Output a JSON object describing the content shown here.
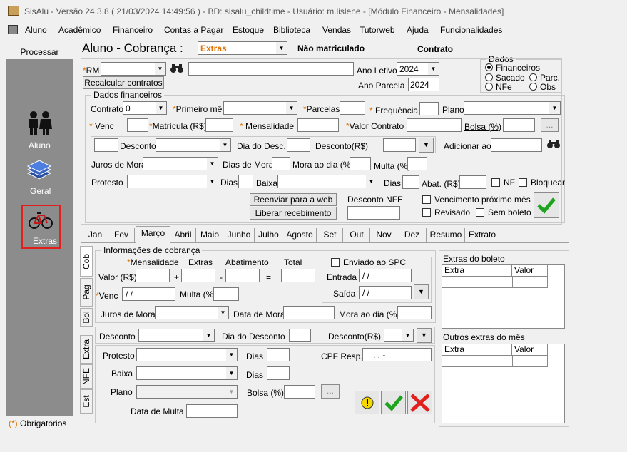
{
  "window": {
    "title": "SisAlu - Versão 24.3.8 ( 21/03/2024 14:49:56 ) - BD: sisalu_childtime - Usuário: m.lislene - [Módulo Financeiro - Mensalidades]",
    "menu": [
      "Aluno",
      "Acadêmico",
      "Financeiro",
      "Contas a Pagar",
      "Estoque",
      "Biblioteca",
      "Vendas",
      "Tutorweb",
      "Ajuda",
      "Funcionalidades"
    ]
  },
  "sidebar": {
    "header": "Processar",
    "items": [
      {
        "label": "Aluno",
        "icon": "people-icon"
      },
      {
        "label": "Geral",
        "icon": "stack-icon"
      },
      {
        "label": "Extras",
        "icon": "bicycle-icon",
        "selected": true
      }
    ],
    "footer_star": "(*)",
    "footer": "Obrigatórios"
  },
  "header": {
    "title": "Aluno  - Cobrança :",
    "type_value": "Extras",
    "status1": "Não matriculado",
    "status2": "Contrato"
  },
  "dados": {
    "title": "Dados",
    "options": [
      "Financeiros",
      "Sacado",
      "Parc.",
      "NFe",
      "Obs"
    ]
  },
  "top": {
    "rm_label": "RM",
    "recalc_button": "Recalcular contratos",
    "ano_letivo_label": "Ano Letivo",
    "ano_letivo_value": "2024",
    "ano_parcela_label": "Ano Parcela",
    "ano_parcela_value": "2024"
  },
  "fin": {
    "title": "Dados financeiros",
    "contrato_label": "Contrato",
    "contrato_value": "0",
    "primeiro_mes_label": "Primeiro mês",
    "parcelas_label": "Parcelas",
    "frequencia_label": "Frequência",
    "plano_label": "Plano",
    "venc_label": "Venc",
    "matricula_label": "Matrícula (R$)",
    "mensalidade_label": "Mensalidade",
    "valor_contrato_label": "Valor Contrato",
    "bolsa_label": "Bolsa (%)",
    "ellipsis": "...",
    "desconto_label": "Desconto",
    "dia_desc_label": "Dia do Desc.",
    "desconto_rs_label": "Desconto(R$)",
    "adicionar_label": "Adicionar ao",
    "juros_label": "Juros de Mora",
    "dias_mora_label": "Dias de Mora",
    "mora_dia_label": "Mora ao dia (%)",
    "multa_label": "Multa (%)",
    "protesto_label": "Protesto",
    "dias_label": "Dias",
    "baixa_label": "Baixa",
    "dias2_label": "Dias",
    "abat_label": "Abat. (R$)",
    "nf_label": "NF",
    "bloquear_label": "Bloquear",
    "reenviar_button": "Reenviar para a web",
    "liberar_button": "Liberar recebimento",
    "desconto_nfe_label": "Desconto NFE",
    "venc_prox_label": "Vencimento próximo mês",
    "revisado_label": "Revisado",
    "sem_boleto_label": "Sem boleto"
  },
  "tabs": [
    "Jan",
    "Fev",
    "Março",
    "Abril",
    "Maio",
    "Junho",
    "Julho",
    "Agosto",
    "Set",
    "Out",
    "Nov",
    "Dez",
    "Resumo",
    "Extrato"
  ],
  "active_tab": "Março",
  "vtabs": [
    "Cob",
    "Pag",
    "Bol",
    "Extra",
    "NFE",
    "Est"
  ],
  "cob": {
    "title": "Informações de cobrança",
    "mensalidade_label": "Mensalidade",
    "extras_label": "Extras",
    "abatimento_label": "Abatimento",
    "total_label": "Total",
    "valor_label": "Valor (R$)",
    "plus": "+",
    "minus": "-",
    "equals": "=",
    "venc_label": "Venc",
    "venc_value": " / /",
    "multa_label": "Multa (%)",
    "spc_label": "Enviado ao SPC",
    "entrada_label": "Entrada",
    "entrada_value": " / /",
    "saida_label": "Saída",
    "saida_value": " / /",
    "juros_label": "Juros de Mora",
    "data_mora_label": "Data de Mora",
    "mora_dia_label": "Mora ao dia (%)",
    "desconto_label": "Desconto",
    "dia_desconto_label": "Dia do Desconto",
    "desconto_rs_label": "Desconto(R$)",
    "protesto_label": "Protesto",
    "dias_label": "Dias",
    "cpf_label": "CPF Resp.",
    "cpf_value": ".   .   -",
    "baixa_label": "Baixa",
    "dias2_label": "Dias",
    "plano_label": "Plano",
    "bolsa_label": "Bolsa (%)",
    "ellipsis": "...",
    "data_multa_label": "Data de Multa"
  },
  "extras_boleto": {
    "title": "Extras do boleto",
    "columns": [
      "Extra",
      "Valor"
    ]
  },
  "outros_extras": {
    "title": "Outros extras do mês",
    "columns": [
      "Extra",
      "Valor"
    ]
  },
  "colors": {
    "check": "#1fa31f",
    "cross": "#e0201c",
    "star": "#e07000",
    "selected_border": "#e0201c"
  }
}
